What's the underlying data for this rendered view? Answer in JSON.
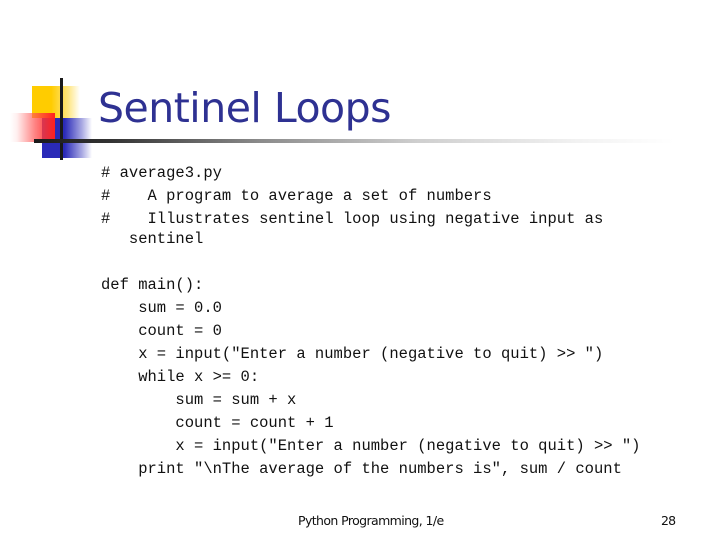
{
  "slide": {
    "title": "Sentinel Loops",
    "colors": {
      "title": "#2e3192",
      "accent_yellow": "#ffcc00",
      "accent_blue": "#2a2ab8",
      "accent_red": "#ff2020"
    },
    "code_lines": [
      "# average3.py",
      "#    A program to average a set of numbers",
      "#    Illustrates sentinel loop using negative input as",
      "   sentinel",
      "",
      "def main():",
      "    sum = 0.0",
      "    count = 0",
      "    x = input(\"Enter a number (negative to quit) >> \")",
      "    while x >= 0:",
      "        sum = sum + x",
      "        count = count + 1",
      "        x = input(\"Enter a number (negative to quit) >> \")",
      "    print \"\\nThe average of the numbers is\", sum / count"
    ],
    "footer": {
      "text": "Python Programming, 1/e",
      "page_number": "28"
    }
  }
}
